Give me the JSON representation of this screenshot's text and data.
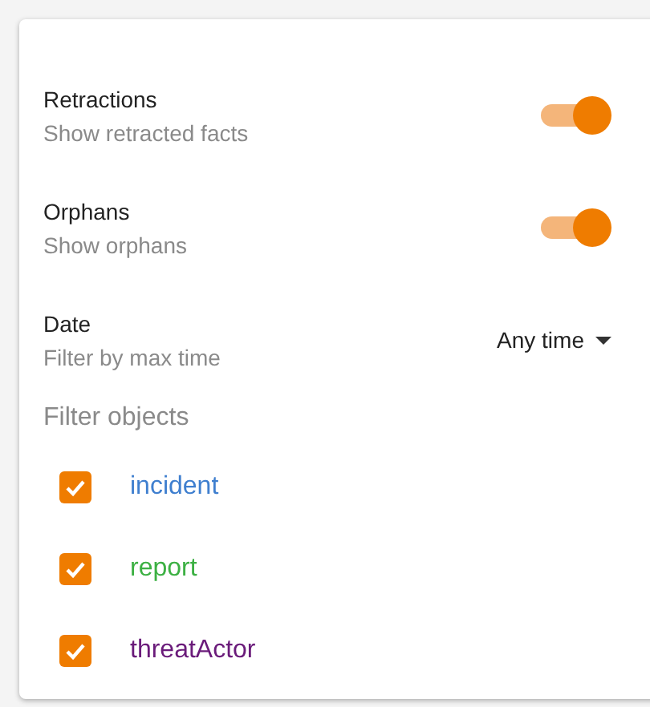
{
  "settings": [
    {
      "kind": "toggle",
      "title": "Retractions",
      "subtitle": "Show retracted facts",
      "on": true
    },
    {
      "kind": "toggle",
      "title": "Orphans",
      "subtitle": "Show orphans",
      "on": true
    },
    {
      "kind": "dropdown",
      "title": "Date",
      "subtitle": "Filter by max time",
      "value": "Any time"
    }
  ],
  "filter_objects": {
    "heading": "Filter objects",
    "items": [
      {
        "label": "incident",
        "checked": true,
        "color": "#3f7fcf"
      },
      {
        "label": "report",
        "checked": true,
        "color": "#3cb043"
      },
      {
        "label": "threatActor",
        "checked": true,
        "color": "#6a1b7a"
      }
    ]
  }
}
